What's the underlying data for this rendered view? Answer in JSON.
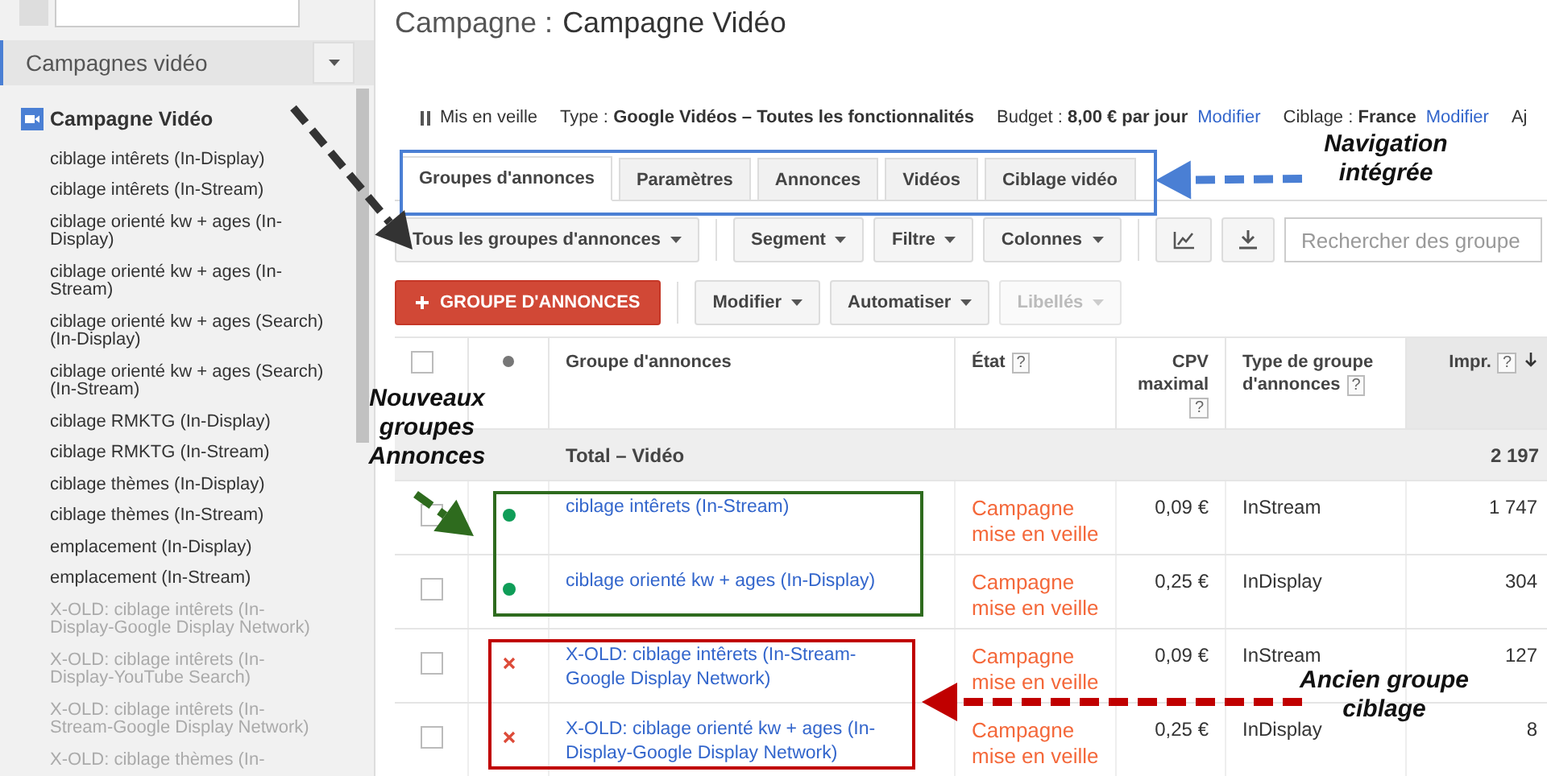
{
  "sidebar": {
    "section": "Campagnes vidéo",
    "campaign": "Campagne Vidéo",
    "items": [
      {
        "label": "ciblage intêrets (In-Display)",
        "disabled": false
      },
      {
        "label": "ciblage intêrets (In-Stream)",
        "disabled": false
      },
      {
        "label": "ciblage orienté kw + ages (In-Display)",
        "disabled": false
      },
      {
        "label": "ciblage orienté kw + ages (In-Stream)",
        "disabled": false
      },
      {
        "label": "ciblage orienté kw + ages (Search) (In-Display)",
        "disabled": false
      },
      {
        "label": "ciblage orienté kw + ages (Search) (In-Stream)",
        "disabled": false
      },
      {
        "label": "ciblage RMKTG (In-Display)",
        "disabled": false
      },
      {
        "label": "ciblage RMKTG (In-Stream)",
        "disabled": false
      },
      {
        "label": "ciblage thèmes (In-Display)",
        "disabled": false
      },
      {
        "label": "ciblage thèmes (In-Stream)",
        "disabled": false
      },
      {
        "label": "emplacement (In-Display)",
        "disabled": false
      },
      {
        "label": "emplacement (In-Stream)",
        "disabled": false
      },
      {
        "label": "X-OLD: ciblage intêrets (In-Display-Google Display Network)",
        "disabled": true
      },
      {
        "label": "X-OLD: ciblage intêrets (In-Display-YouTube Search)",
        "disabled": true
      },
      {
        "label": "X-OLD: ciblage intêrets (In-Stream-Google Display Network)",
        "disabled": true
      },
      {
        "label": "X-OLD: ciblage thèmes (In-",
        "disabled": true
      }
    ]
  },
  "header": {
    "label": "Campagne :",
    "name": "Campagne Vidéo"
  },
  "info": {
    "status": "Mis en veille",
    "type": "Type : **Google Vidéos – Toutes les fonctionnalités**",
    "budget": "Budget : **8,00 € par jour**",
    "budget_link": "Modifier",
    "targeting": "Ciblage : **France**",
    "targeting_link": "Modifier",
    "cut": "Aj"
  },
  "tabs": [
    {
      "label": "Groupes d'annonces",
      "selected": true
    },
    {
      "label": "Paramètres",
      "selected": false
    },
    {
      "label": "Annonces",
      "selected": false
    },
    {
      "label": "Vidéos",
      "selected": false
    },
    {
      "label": "Ciblage vidéo",
      "selected": false
    }
  ],
  "toolbar": {
    "filter": "Tous les groupes d'annonces",
    "menus": [
      "Segment",
      "Filtre",
      "Colonnes"
    ],
    "search_placeholder": "Rechercher des groupe"
  },
  "actions": {
    "primary": "GROUPE D'ANNONCES",
    "menus": [
      {
        "label": "Modifier",
        "disabled": false
      },
      {
        "label": "Automatiser",
        "disabled": false
      },
      {
        "label": "Libellés",
        "disabled": true
      }
    ]
  },
  "table": {
    "columns": [
      {
        "label": "Groupe d'annonces"
      },
      {
        "label": "État",
        "help": "?"
      },
      {
        "label": "CPV maximal",
        "help": "?"
      },
      {
        "label": "Type de groupe d'annonces",
        "help": "?"
      },
      {
        "label": "Impr.",
        "help": "?",
        "sorted": true
      }
    ],
    "select_all_checked": false,
    "total": {
      "label": "Total – Vidéo",
      "impressions": "2 197"
    },
    "rows": [
      {
        "removed": false,
        "name": "ciblage intêrets (In-Stream)",
        "state": "Campagne mise en veille",
        "cpv": "0,09 €",
        "type": "InStream",
        "impressions": "1 747",
        "checked": false
      },
      {
        "removed": false,
        "name": "ciblage orienté kw + ages (In-Display)",
        "state": "Campagne mise en veille",
        "cpv": "0,25 €",
        "type": "InDisplay",
        "impressions": "304",
        "checked": false
      },
      {
        "removed": true,
        "name": "X-OLD: ciblage intêrets (In-Stream-Google Display Network)",
        "state": "Campagne mise en veille",
        "cpv": "0,09 €",
        "type": "InStream",
        "impressions": "127",
        "checked": false
      },
      {
        "removed": true,
        "name": "X-OLD: ciblage orienté kw + ages (In-Display-Google Display Network)",
        "state": "Campagne mise en veille",
        "cpv": "0,25 €",
        "type": "InDisplay",
        "impressions": "8",
        "checked": false
      }
    ]
  },
  "annotations": [
    {
      "kind": "callout",
      "text": "Navigation intégrée",
      "color": "#4a7fd4"
    },
    {
      "kind": "callout",
      "text": "Nouveaux groupes Annonces",
      "color": "#2e6b1e"
    },
    {
      "kind": "callout",
      "text": "Ancien groupe ciblage",
      "color": "#c00000"
    },
    {
      "kind": "arrow",
      "color": "#333333"
    }
  ]
}
